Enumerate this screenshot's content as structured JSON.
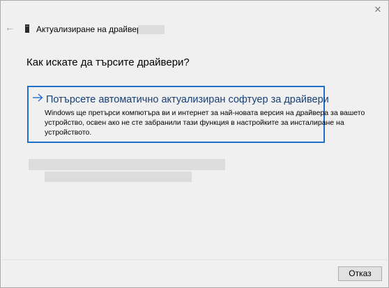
{
  "window": {
    "title": "Актуализиране на драйвери",
    "close_glyph": "✕",
    "back_glyph": "←"
  },
  "main": {
    "question": "Как искате да търсите драйвери?",
    "option": {
      "title": "Потърсете автоматично актуализиран софтуер за драйвери",
      "description": "Windows ще претърси компютъра ви и интернет за най-новата версия на драйвера за вашето устройство, освен ако не сте забранили тази функция в настройките за инсталиране на устройството."
    }
  },
  "footer": {
    "cancel_label": "Отказ"
  },
  "colors": {
    "accent": "#1e6fc9",
    "link_text": "#14407a",
    "background": "#f0f0f0"
  },
  "icons": {
    "close": "close-icon",
    "back": "back-arrow-icon",
    "device": "device-icon",
    "option_arrow": "arrow-right-icon"
  }
}
